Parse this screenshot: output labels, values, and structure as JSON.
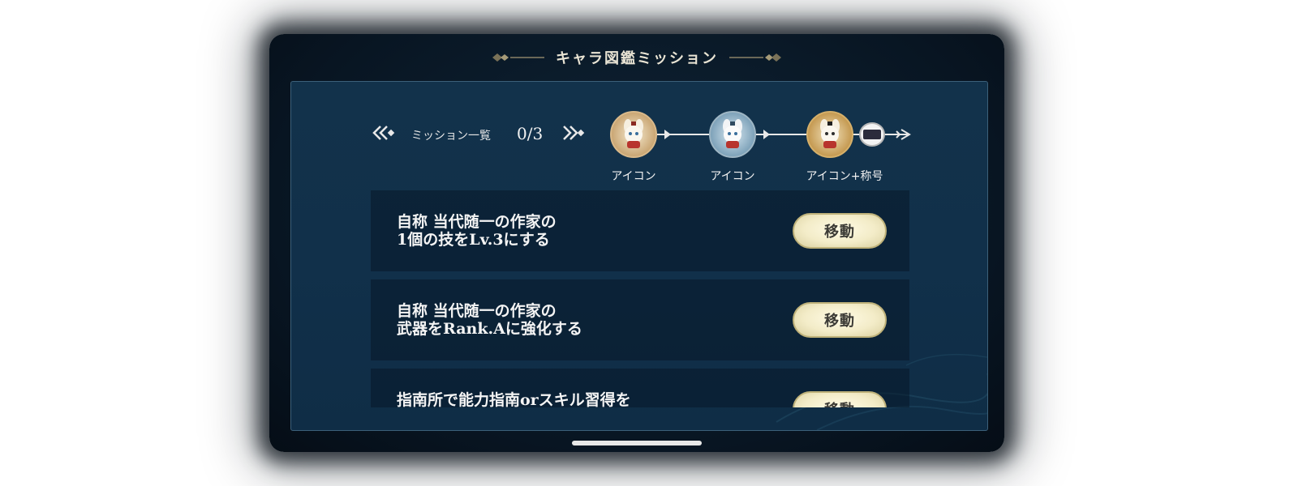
{
  "dialog": {
    "title": "キャラ図鑑ミッション"
  },
  "progress": {
    "label": "ミッション一覧",
    "count": "0/3"
  },
  "rewards": [
    {
      "label": "アイコン",
      "icon": "character-icon-white"
    },
    {
      "label": "アイコン",
      "icon": "character-icon-blue"
    },
    {
      "label": "アイコン+称号",
      "icon": "character-icon-gold"
    }
  ],
  "missions": [
    {
      "line1": "自称 当代随一の作家の",
      "line2": "1個の技をLv.3にする",
      "button": "移動"
    },
    {
      "line1": "自称 当代随一の作家の",
      "line2": "武器をRank.Aに強化する",
      "button": "移動"
    },
    {
      "line1": "指南所で能力指南orスキル習得を",
      "line2": "",
      "button": "移動"
    }
  ],
  "colors": {
    "panel_bg": "#12324b",
    "button_bg": "#f3ecc8",
    "text": "#f4f4f4"
  }
}
